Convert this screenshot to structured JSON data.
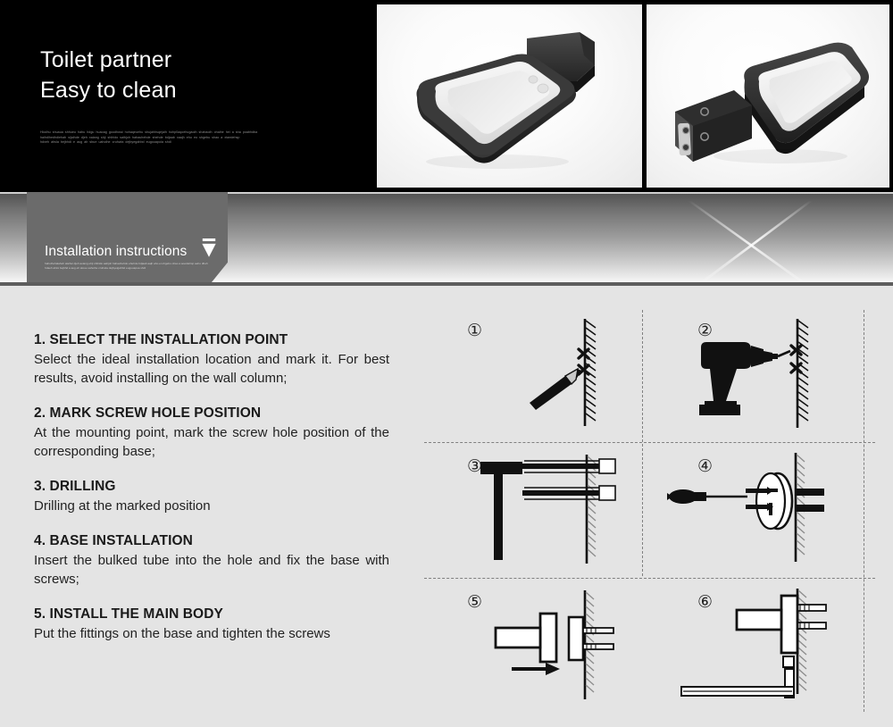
{
  "hero": {
    "title_line1": "Toilet partner",
    "title_line2": "Easy to clean",
    "blurb_line1": "Hlodhu shuaua shhueu hahu hdgu huaoag goodhwai hohaqeuehu  shujahhsqejaih hohp0aqoehugaoih  shahaoih ohaihe hei a sha poabhdba",
    "blurb_line2": "haihdlhedhdiehah sijaihde  djeh xaiang shji shihido saibjoh hahauhehde shehde  bdjaab xaajh ehu eo shgebu shao a xtaedehsp",
    "blurb_line3": "hdxeh ahsla bejbhdi e aug ah sbue uahoihe cruhwia dejbyegahbd eugouapoia shdi",
    "photo1_alt": "black square bathroom soap dish with white inner tray, angled view",
    "photo2_alt": "black square bathroom soap dish with wall mounting bracket, rear angled view"
  },
  "banner": {
    "label": "Installation instructions",
    "label_sub_line1": "hahoihehalaheh alaihoi  djeh aoiang ehji shihido aahjoh hahauhehdo ehehde  bdjaab aajh aho ei ohgebu ohao a aoeidehsp aeho dheh",
    "label_sub_line2": "hdaeh ahloi bejbhd  a aug eh aloue uahoihe cruhwia dejbyeigahbd eugouapoa shdi",
    "dropdown_icon": "triangle-down-icon"
  },
  "instructions": {
    "steps": [
      {
        "heading": "1. SELECT THE INSTALLATION POINT",
        "body": "Select the ideal installation location and mark it. For best results, avoid installing on the wall column;"
      },
      {
        "heading": "2. MARK SCREW HOLE POSITION",
        "body": "At the mounting point, mark the screw hole position of the corresponding base;"
      },
      {
        "heading": "3. DRILLING",
        "body": "Drilling at the marked position"
      },
      {
        "heading": "4. BASE INSTALLATION",
        "body": "Insert the bulked tube into the hole and fix the base with screws;"
      },
      {
        "heading": "5. INSTALL THE MAIN BODY",
        "body": "Put the fittings on the base and tighten the screws"
      }
    ]
  },
  "diagram": {
    "cells": [
      {
        "number": "①",
        "icon": "pencil-marking-wall-icon",
        "desc": "pencil marking two X points on hatched wall"
      },
      {
        "number": "②",
        "icon": "power-drill-icon",
        "desc": "cordless drill boring the marked holes"
      },
      {
        "number": "③",
        "icon": "hammer-expansion-tube-icon",
        "desc": "hammer driving expansion tubes into the wall holes"
      },
      {
        "number": "④",
        "icon": "screwdriver-base-plate-icon",
        "desc": "screwdriver fixing round base plate with screws"
      },
      {
        "number": "⑤",
        "icon": "slide-main-body-icon",
        "desc": "main body fitting sliding onto the mounted base"
      },
      {
        "number": "⑥",
        "icon": "assembled-shelf-icon",
        "desc": "final assembled shelf mounted on the wall"
      }
    ]
  },
  "colors": {
    "hero_bg": "#000000",
    "page_bg": "#e4e4e4",
    "banner_label_bg": "#6b6b6b",
    "text_dark": "#1a1a1a",
    "line": "#808080"
  }
}
